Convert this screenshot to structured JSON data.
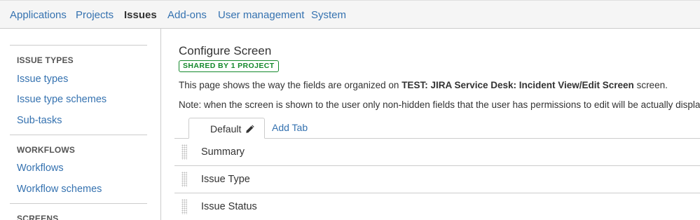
{
  "topnav": {
    "items": [
      {
        "label": "Applications"
      },
      {
        "label": "Projects"
      },
      {
        "label": "Issues"
      },
      {
        "label": "Add-ons"
      },
      {
        "label": "User management"
      },
      {
        "label": "System"
      }
    ],
    "active": "Issues"
  },
  "sidebar": {
    "sections": [
      {
        "heading": "ISSUE TYPES",
        "links": [
          "Issue types",
          "Issue type schemes",
          "Sub-tasks"
        ]
      },
      {
        "heading": "WORKFLOWS",
        "links": [
          "Workflows",
          "Workflow schemes"
        ]
      },
      {
        "heading": "SCREENS",
        "links": []
      }
    ]
  },
  "main": {
    "title": "Configure Screen",
    "shared_badge": "SHARED BY 1 PROJECT",
    "desc_prefix": "This page shows the way the fields are organized on ",
    "desc_screen": "TEST: JIRA Service Desk: Incident View/Edit Screen",
    "desc_suffix": " screen.",
    "note": "Note: when the screen is shown to the user only non-hidden fields that the user has permissions to edit will be actually displayed.",
    "tabs": {
      "active_label": "Default",
      "add_label": "Add Tab"
    },
    "fields": [
      "Summary",
      "Issue Type",
      "Issue Status"
    ]
  },
  "colors": {
    "link": "#3572b0",
    "badge_green": "#14892c",
    "border": "#cccccc",
    "nav_bg": "#f5f5f5"
  },
  "icons": {
    "edit_tab": "pencil-icon",
    "drag": "drag-handle-icon"
  }
}
